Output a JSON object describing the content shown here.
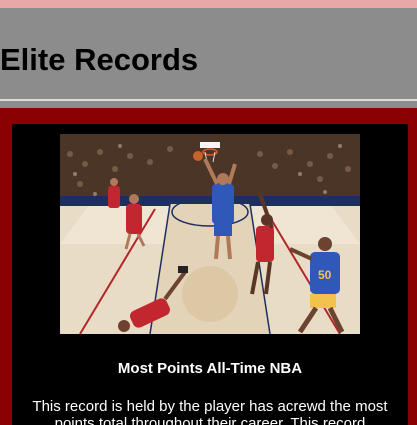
{
  "header": {
    "title": "Elite Records"
  },
  "card": {
    "image_alt": "Basketball game action photo",
    "title": "Most Points All-Time NBA",
    "body": "This record is held by the player has acrewd the most points total throughout their career. This record"
  },
  "colors": {
    "top_strip": "#e6a8a8",
    "header_bg": "#8c8c8c",
    "section_bg": "#8b0000",
    "card_bg": "#000000",
    "card_text": "#ffffff"
  }
}
